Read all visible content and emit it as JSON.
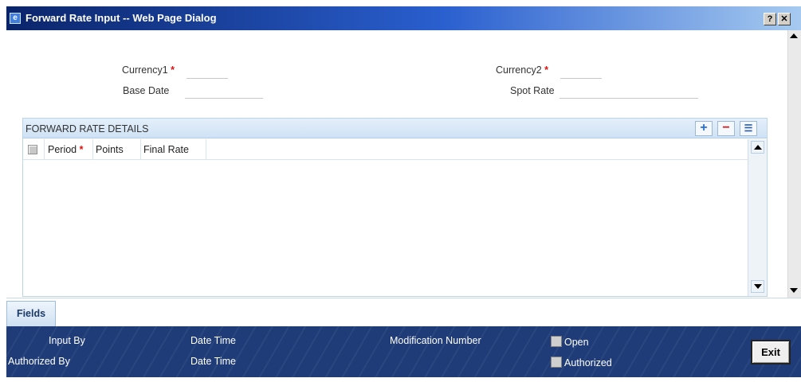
{
  "window": {
    "title": "Forward Rate Input -- Web Page Dialog",
    "help_label": "?",
    "close_label": "✕"
  },
  "form": {
    "currency1_label": "Currency1",
    "currency2_label": "Currency2",
    "base_date_label": "Base Date",
    "spot_rate_label": "Spot Rate",
    "required_marker": "*",
    "currency1_value": "",
    "currency2_value": "",
    "base_date_value": "",
    "spot_rate_value": ""
  },
  "grid": {
    "title": "FORWARD RATE DETAILS",
    "add_label": "+",
    "delete_label": "−",
    "columns_label": "☰",
    "columns": [
      "Period",
      "Points",
      "Final Rate"
    ],
    "rows": []
  },
  "tabs": {
    "fields_label": "Fields"
  },
  "footer": {
    "input_by_label": "Input By",
    "authorized_by_label": "Authorized By",
    "date_time_label": "Date Time",
    "modification_number_label": "Modification Number",
    "open_label": "Open",
    "authorized_label": "Authorized",
    "exit_label": "Exit"
  },
  "colors": {
    "title_bar": "#0a246a",
    "footer_bg": "#1f3c78",
    "required": "#e01010",
    "grid_header": "#cfe2f5"
  }
}
